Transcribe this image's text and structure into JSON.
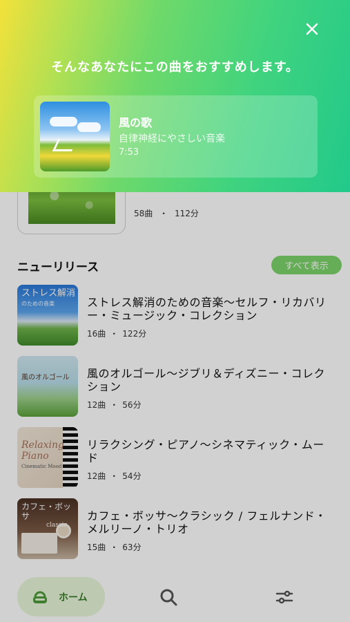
{
  "playlist": {
    "meta_tracks": "58曲",
    "meta_separator": "・",
    "meta_duration": "112分"
  },
  "new_releases": {
    "title": "ニューリリース",
    "see_all": "すべて表示",
    "items": [
      {
        "title": "ストレス解消のための音楽〜セルフ・リカバリー・ミュージック・コレクション",
        "tracks": "16曲",
        "duration": "122分",
        "cover_text": "ストレス解消",
        "cover_subtext": "のための音楽"
      },
      {
        "title": "風のオルゴール〜ジブリ＆ディズニー・コレクション",
        "tracks": "12曲",
        "duration": "56分",
        "cover_text": "風のオルゴール",
        "cover_subtext": ""
      },
      {
        "title": "リラクシング・ピアノ〜シネマティック・ムード",
        "tracks": "12曲",
        "duration": "54分",
        "cover_text": "Relaxing Piano",
        "cover_subtext": "Cinematic Mood"
      },
      {
        "title": "カフェ・ボッサ〜クラシック / フェルナンド・メルリーノ・トリオ",
        "tracks": "15曲",
        "duration": "63分",
        "cover_text": "カフェ・ボッサ",
        "cover_subtext": "classic"
      }
    ],
    "separator": "・"
  },
  "bottom_nav": {
    "home_label": "ホーム"
  },
  "recommendation": {
    "heading": "そんなあなたにこの曲をおすすめします。",
    "title": "風の歌",
    "subtitle": "自律神経にやさしい音楽",
    "duration": "7:53"
  },
  "colors": {
    "accent_green": "#7dd36b",
    "banner_start": "#f3e13a",
    "banner_end": "#22c98a"
  }
}
